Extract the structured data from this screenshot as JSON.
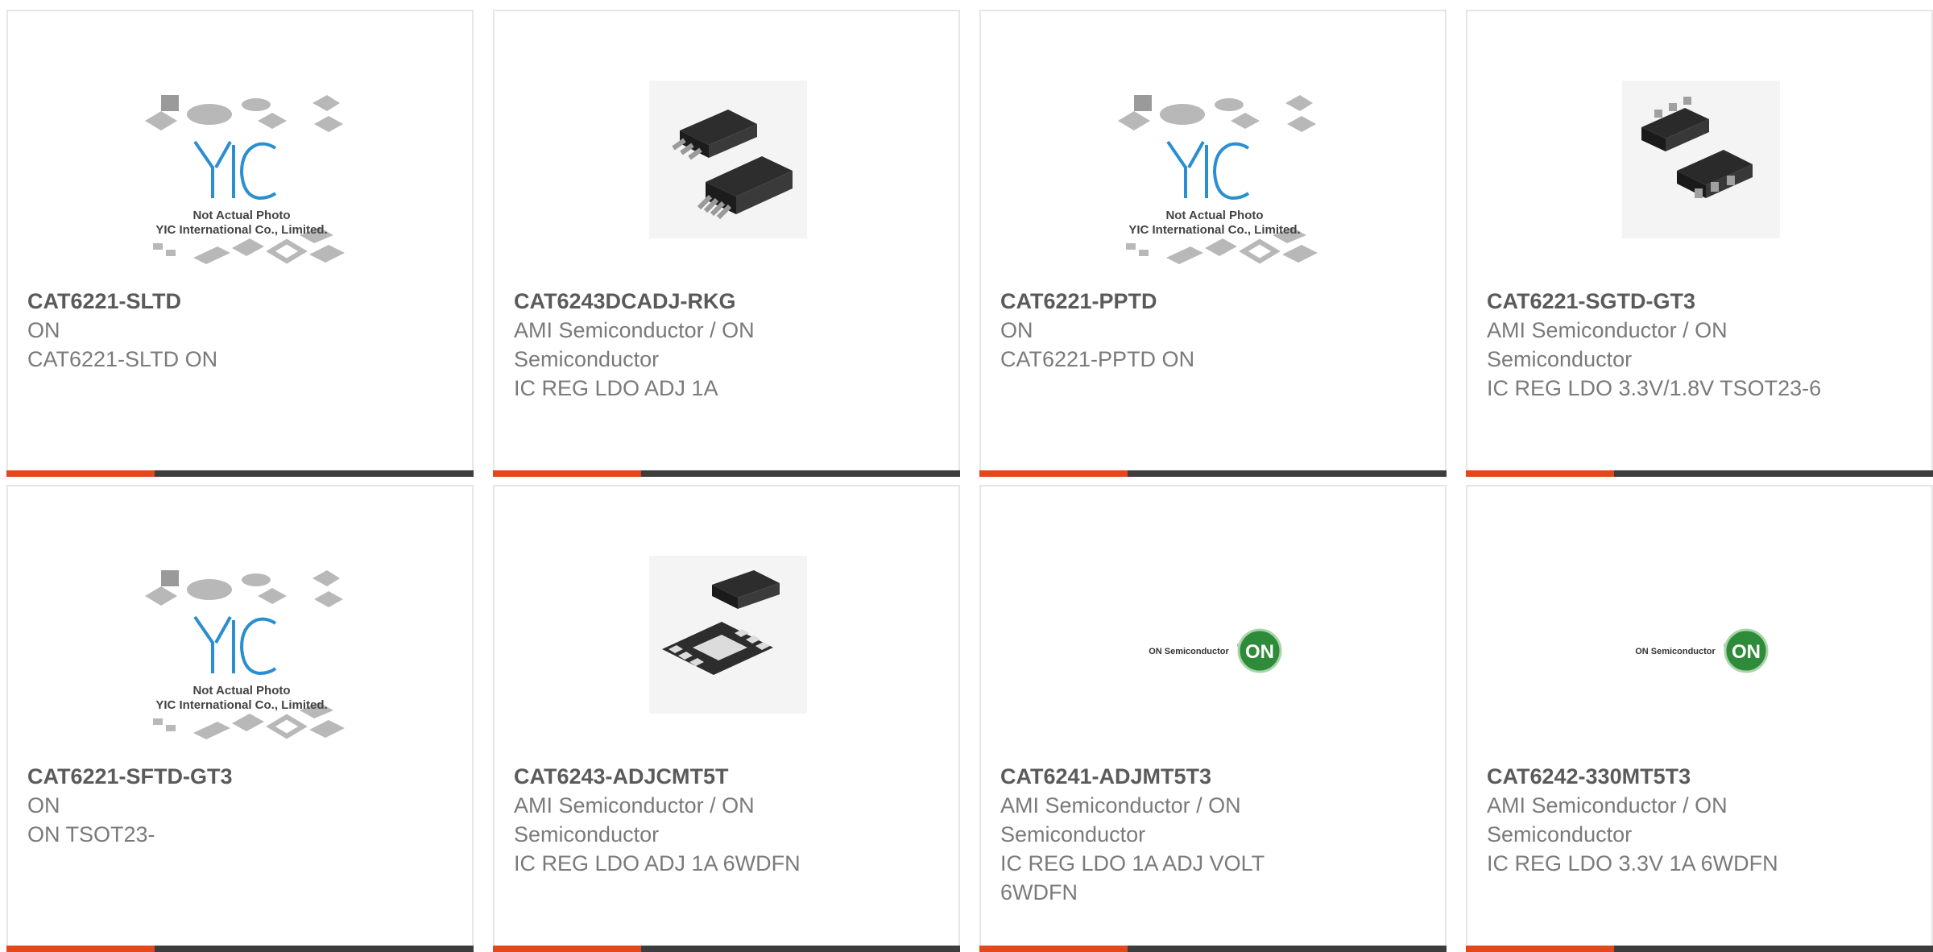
{
  "products": [
    {
      "part_number": "CAT6221-SLTD",
      "manufacturer": "ON",
      "description": "CAT6221-SLTD ON",
      "image": "yic-placeholder"
    },
    {
      "part_number": "CAT6243DCADJ-RKG",
      "manufacturer": "AMI Semiconductor / ON Semiconductor",
      "description": "IC REG LDO ADJ 1A",
      "image": "dpak-5-package"
    },
    {
      "part_number": "CAT6221-PPTD",
      "manufacturer": "ON",
      "description": "CAT6221-PPTD ON",
      "image": "yic-placeholder"
    },
    {
      "part_number": "CAT6221-SGTD-GT3",
      "manufacturer": "AMI Semiconductor / ON Semiconductor",
      "description": "IC REG LDO 3.3V/1.8V TSOT23-6",
      "image": "tsot23-6-package"
    },
    {
      "part_number": "CAT6221-SFTD-GT3",
      "manufacturer": "ON",
      "description": "ON TSOT23-",
      "image": "yic-placeholder"
    },
    {
      "part_number": "CAT6243-ADJCMT5T",
      "manufacturer": "AMI Semiconductor / ON Semiconductor",
      "description": "IC REG LDO ADJ 1A 6WDFN",
      "image": "wdfn-6-package"
    },
    {
      "part_number": "CAT6241-ADJMT5T3",
      "manufacturer": "AMI Semiconductor / ON Semiconductor",
      "description": "IC REG LDO 1A ADJ VOLT 6WDFN",
      "image": "on-semi-logo"
    },
    {
      "part_number": "CAT6242-330MT5T3",
      "manufacturer": "AMI Semiconductor / ON Semiconductor",
      "description": "IC REG LDO 3.3V 1A 6WDFN",
      "image": "on-semi-logo"
    }
  ],
  "placeholder": {
    "brand": "YIC",
    "line1": "Not Actual Photo",
    "line2": "YIC International Co., Limited."
  },
  "on_logo": {
    "wordmark": "ON Semiconductor",
    "trademark": "®",
    "badge": "ON"
  },
  "colors": {
    "accent": "#e5471c",
    "bar": "#3d3d3d",
    "border": "#e6e6e6",
    "title": "#5a5a5a",
    "text": "#7a7a7a",
    "yic_blue": "#2a8fd0",
    "on_green": "#2e8b3a"
  }
}
